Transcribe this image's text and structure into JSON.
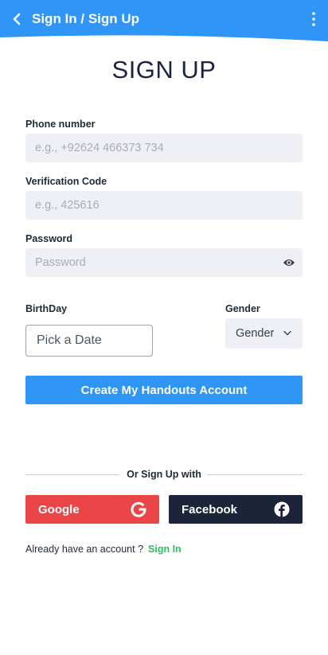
{
  "appbar": {
    "title": "Sign In / Sign Up"
  },
  "page": {
    "heading": "SIGN UP"
  },
  "form": {
    "phone": {
      "label": "Phone number",
      "placeholder": "e.g., +92624 466373 734",
      "value": ""
    },
    "code": {
      "label": "Verification Code",
      "placeholder": "e.g., 425616",
      "value": ""
    },
    "password": {
      "label": "Password",
      "placeholder": "Password",
      "value": ""
    },
    "birthday": {
      "label": "BirthDay",
      "placeholder": "Pick a Date"
    },
    "gender": {
      "label": "Gender",
      "selected": "Gender"
    },
    "submit_label": "Create My Handouts Account"
  },
  "social": {
    "divider_text": "Or Sign Up with",
    "google_label": "Google",
    "facebook_label": "Facebook"
  },
  "footer": {
    "prompt": "Already have an account ?",
    "link": "Sign In"
  },
  "colors": {
    "primary": "#2f95f7",
    "google": "#ea4648",
    "facebook": "#1b2438",
    "link": "#22c55e",
    "field_bg": "#eef0f6"
  },
  "icons": [
    "chevron-left-icon",
    "kebab-menu-icon",
    "eye-icon",
    "chevron-down-icon",
    "google-icon",
    "facebook-icon"
  ]
}
